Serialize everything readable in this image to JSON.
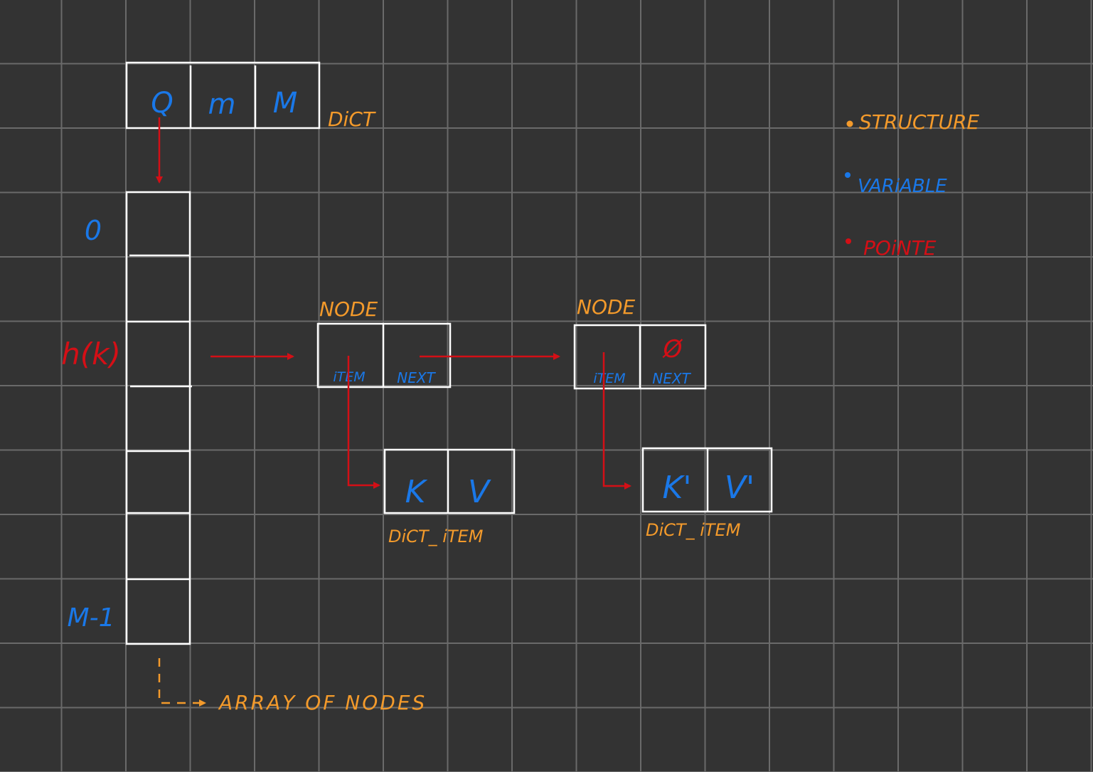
{
  "colors": {
    "background": "#333333",
    "grid": "#6a6a6a",
    "box": "#ffffff",
    "structure": "#f39a2b",
    "variable": "#1a78e8",
    "pointer": "#d40f16"
  },
  "dict": {
    "fields": [
      "Q",
      "m",
      "M"
    ],
    "label": "DiCT"
  },
  "array": {
    "index_first": "0",
    "index_hash": "h(k)",
    "index_last": "M-1",
    "caption": "ARRAY OF NODES"
  },
  "nodes": [
    {
      "title": "NODE",
      "item_label": "iTEM",
      "next_label": "NEXT",
      "next_value": ""
    },
    {
      "title": "NODE",
      "item_label": "iTEM",
      "next_label": "NEXT",
      "next_value": "Ø"
    }
  ],
  "dict_items": [
    {
      "key": "K",
      "value": "V",
      "label": "DiCT_ iTEM"
    },
    {
      "key": "K'",
      "value": "V'",
      "label": "DiCT_ iTEM"
    }
  ],
  "legend": [
    {
      "text": "STRUCTURE",
      "color": "#f39a2b"
    },
    {
      "text": "VARiABLE",
      "color": "#1a78e8"
    },
    {
      "text": "POiNTE",
      "color": "#d40f16"
    }
  ]
}
